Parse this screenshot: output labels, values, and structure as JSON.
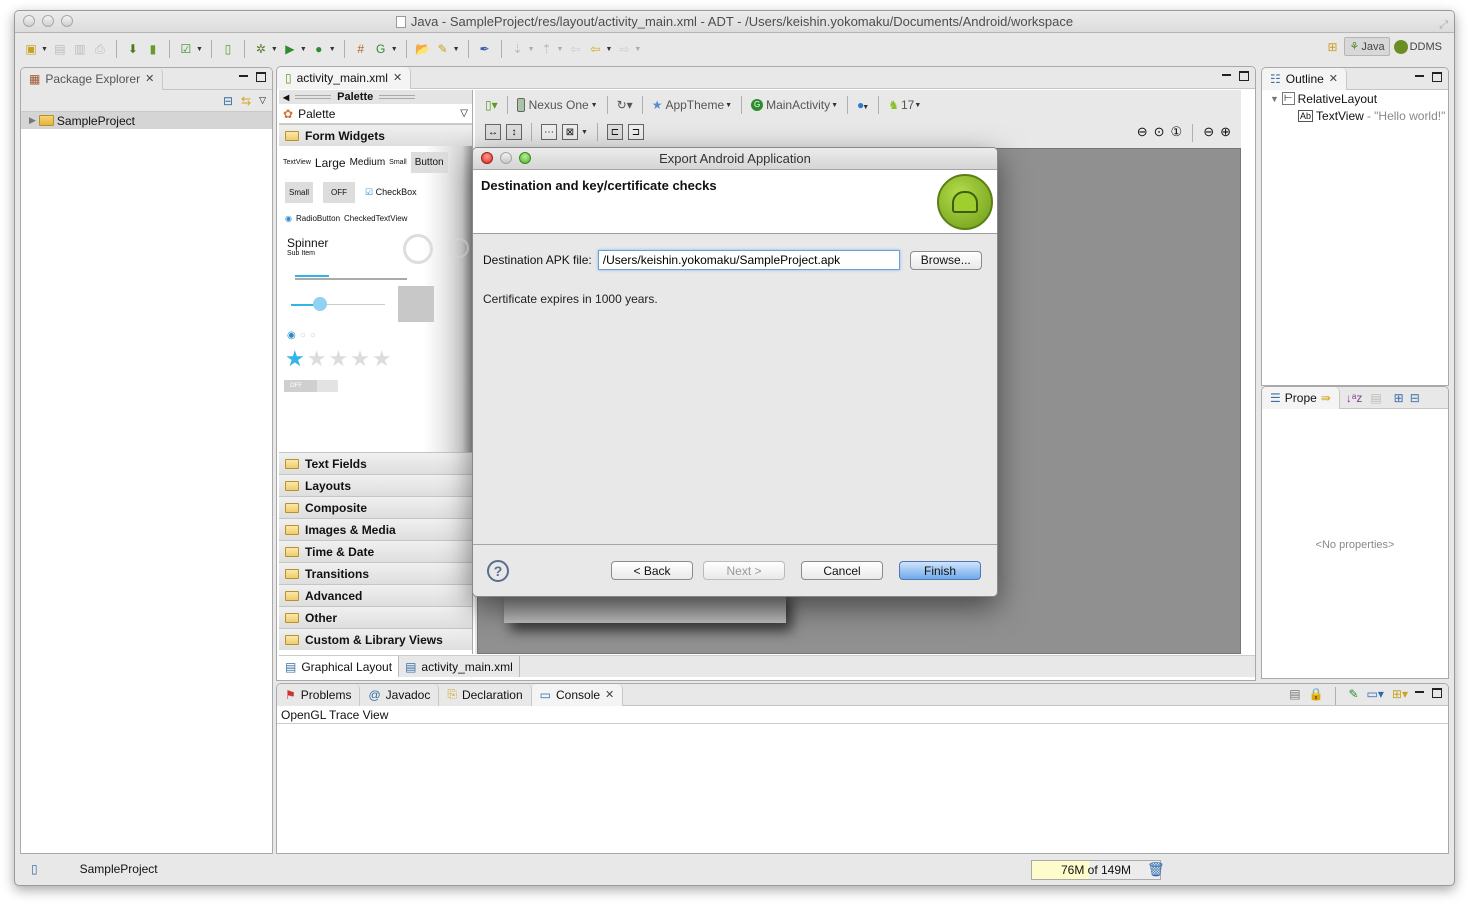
{
  "window": {
    "title": "Java - SampleProject/res/layout/activity_main.xml - ADT - /Users/keishin.yokomaku/Documents/Android/workspace"
  },
  "perspectives": {
    "items": [
      {
        "label": "Java",
        "active": true
      },
      {
        "label": "DDMS",
        "active": false
      }
    ]
  },
  "package_explorer": {
    "tab_label": "Package Explorer",
    "tree": [
      {
        "label": "SampleProject",
        "expanded": false,
        "selected": true
      }
    ]
  },
  "editor": {
    "tab_label": "activity_main.xml",
    "palette": {
      "header": "Palette",
      "dropdown_label": "Palette",
      "open_category": "Form Widgets",
      "widget_preview": {
        "row1": [
          "TextView",
          "Large",
          "Medium",
          "Small",
          "Button"
        ],
        "row2": [
          "Small",
          "OFF",
          "CheckBox"
        ],
        "row3": [
          "RadioButton",
          "CheckedTextView"
        ],
        "spinner_title": "Spinner",
        "spinner_sub": "Sub Item",
        "rating_filled_stars": 1,
        "rating_total_stars": 5,
        "switch_label": "OFF"
      },
      "categories": [
        "Text Fields",
        "Layouts",
        "Composite",
        "Images & Media",
        "Time & Date",
        "Transitions",
        "Advanced",
        "Other",
        "Custom & Library Views"
      ]
    },
    "config_bar": {
      "device": "Nexus One",
      "theme": "AppTheme",
      "activity": "MainActivity",
      "api_level": "17"
    },
    "bottom_tabs": [
      {
        "label": "Graphical Layout",
        "active": true
      },
      {
        "label": "activity_main.xml",
        "active": false
      }
    ]
  },
  "outline": {
    "tab_label": "Outline",
    "tree": [
      {
        "label": "RelativeLayout",
        "detail": ""
      },
      {
        "label": "TextView",
        "detail": " - \"Hello world!\""
      }
    ]
  },
  "properties": {
    "tab_label": "Prope",
    "empty_text": "<No properties>"
  },
  "console_area": {
    "tabs": [
      {
        "label": "Problems",
        "active": false
      },
      {
        "label": "Javadoc",
        "active": false
      },
      {
        "label": "Declaration",
        "active": false
      },
      {
        "label": "Console",
        "active": true
      }
    ],
    "view_title": "OpenGL Trace View"
  },
  "status_bar": {
    "selection": "SampleProject",
    "heap": "76M of 149M",
    "heap_used_fraction": 0.51
  },
  "dialog": {
    "title": "Export Android Application",
    "heading": "Destination and key/certificate checks",
    "field_label": "Destination APK file:",
    "field_value": "/Users/keishin.yokomaku/SampleProject.apk",
    "browse_label": "Browse...",
    "certificate_message": "Certificate expires in 1000 years.",
    "buttons": {
      "back": "< Back",
      "next": "Next >",
      "cancel": "Cancel",
      "finish": "Finish"
    },
    "help_glyph": "?"
  }
}
